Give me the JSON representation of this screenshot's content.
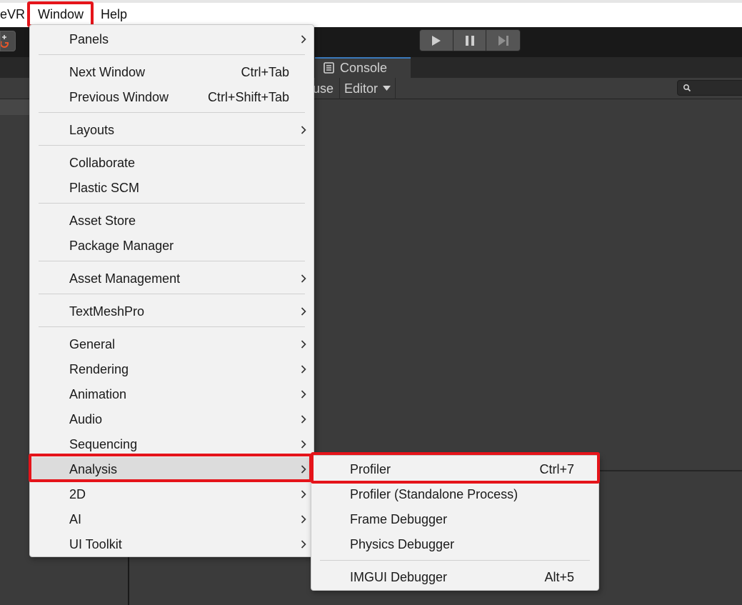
{
  "menubar": {
    "items": [
      {
        "label": "eVR"
      },
      {
        "label": "Window"
      },
      {
        "label": "Help"
      }
    ]
  },
  "toolbar": {
    "play_icon": "play-icon",
    "pause_icon": "pause-icon",
    "step_icon": "step-icon"
  },
  "tabs": {
    "console": "Console"
  },
  "subbar": {
    "partial_label": "use",
    "editor_dropdown": "Editor"
  },
  "window_menu": {
    "items": [
      {
        "label": "Panels",
        "shortcut": "",
        "submenu": true
      },
      {
        "label": "Next Window",
        "shortcut": "Ctrl+Tab",
        "submenu": false
      },
      {
        "label": "Previous Window",
        "shortcut": "Ctrl+Shift+Tab",
        "submenu": false
      },
      {
        "label": "Layouts",
        "shortcut": "",
        "submenu": true
      },
      {
        "label": "Collaborate",
        "shortcut": "",
        "submenu": false
      },
      {
        "label": "Plastic SCM",
        "shortcut": "",
        "submenu": false
      },
      {
        "label": "Asset Store",
        "shortcut": "",
        "submenu": false
      },
      {
        "label": "Package Manager",
        "shortcut": "",
        "submenu": false
      },
      {
        "label": "Asset Management",
        "shortcut": "",
        "submenu": true
      },
      {
        "label": "TextMeshPro",
        "shortcut": "",
        "submenu": true
      },
      {
        "label": "General",
        "shortcut": "",
        "submenu": true
      },
      {
        "label": "Rendering",
        "shortcut": "",
        "submenu": true
      },
      {
        "label": "Animation",
        "shortcut": "",
        "submenu": true
      },
      {
        "label": "Audio",
        "shortcut": "",
        "submenu": true
      },
      {
        "label": "Sequencing",
        "shortcut": "",
        "submenu": true
      },
      {
        "label": "Analysis",
        "shortcut": "",
        "submenu": true
      },
      {
        "label": "2D",
        "shortcut": "",
        "submenu": true
      },
      {
        "label": "AI",
        "shortcut": "",
        "submenu": true
      },
      {
        "label": "UI Toolkit",
        "shortcut": "",
        "submenu": true
      }
    ]
  },
  "analysis_menu": {
    "items": [
      {
        "label": "Profiler",
        "shortcut": "Ctrl+7"
      },
      {
        "label": "Profiler (Standalone Process)",
        "shortcut": ""
      },
      {
        "label": "Frame Debugger",
        "shortcut": ""
      },
      {
        "label": "Physics Debugger",
        "shortcut": ""
      },
      {
        "label": "IMGUI Debugger",
        "shortcut": "Alt+5"
      }
    ]
  },
  "colors": {
    "highlight": "#e5141a",
    "menu_bg": "#f2f2f2",
    "editor_bg": "#3b3b3b",
    "tab_accent": "#3a79bb"
  }
}
